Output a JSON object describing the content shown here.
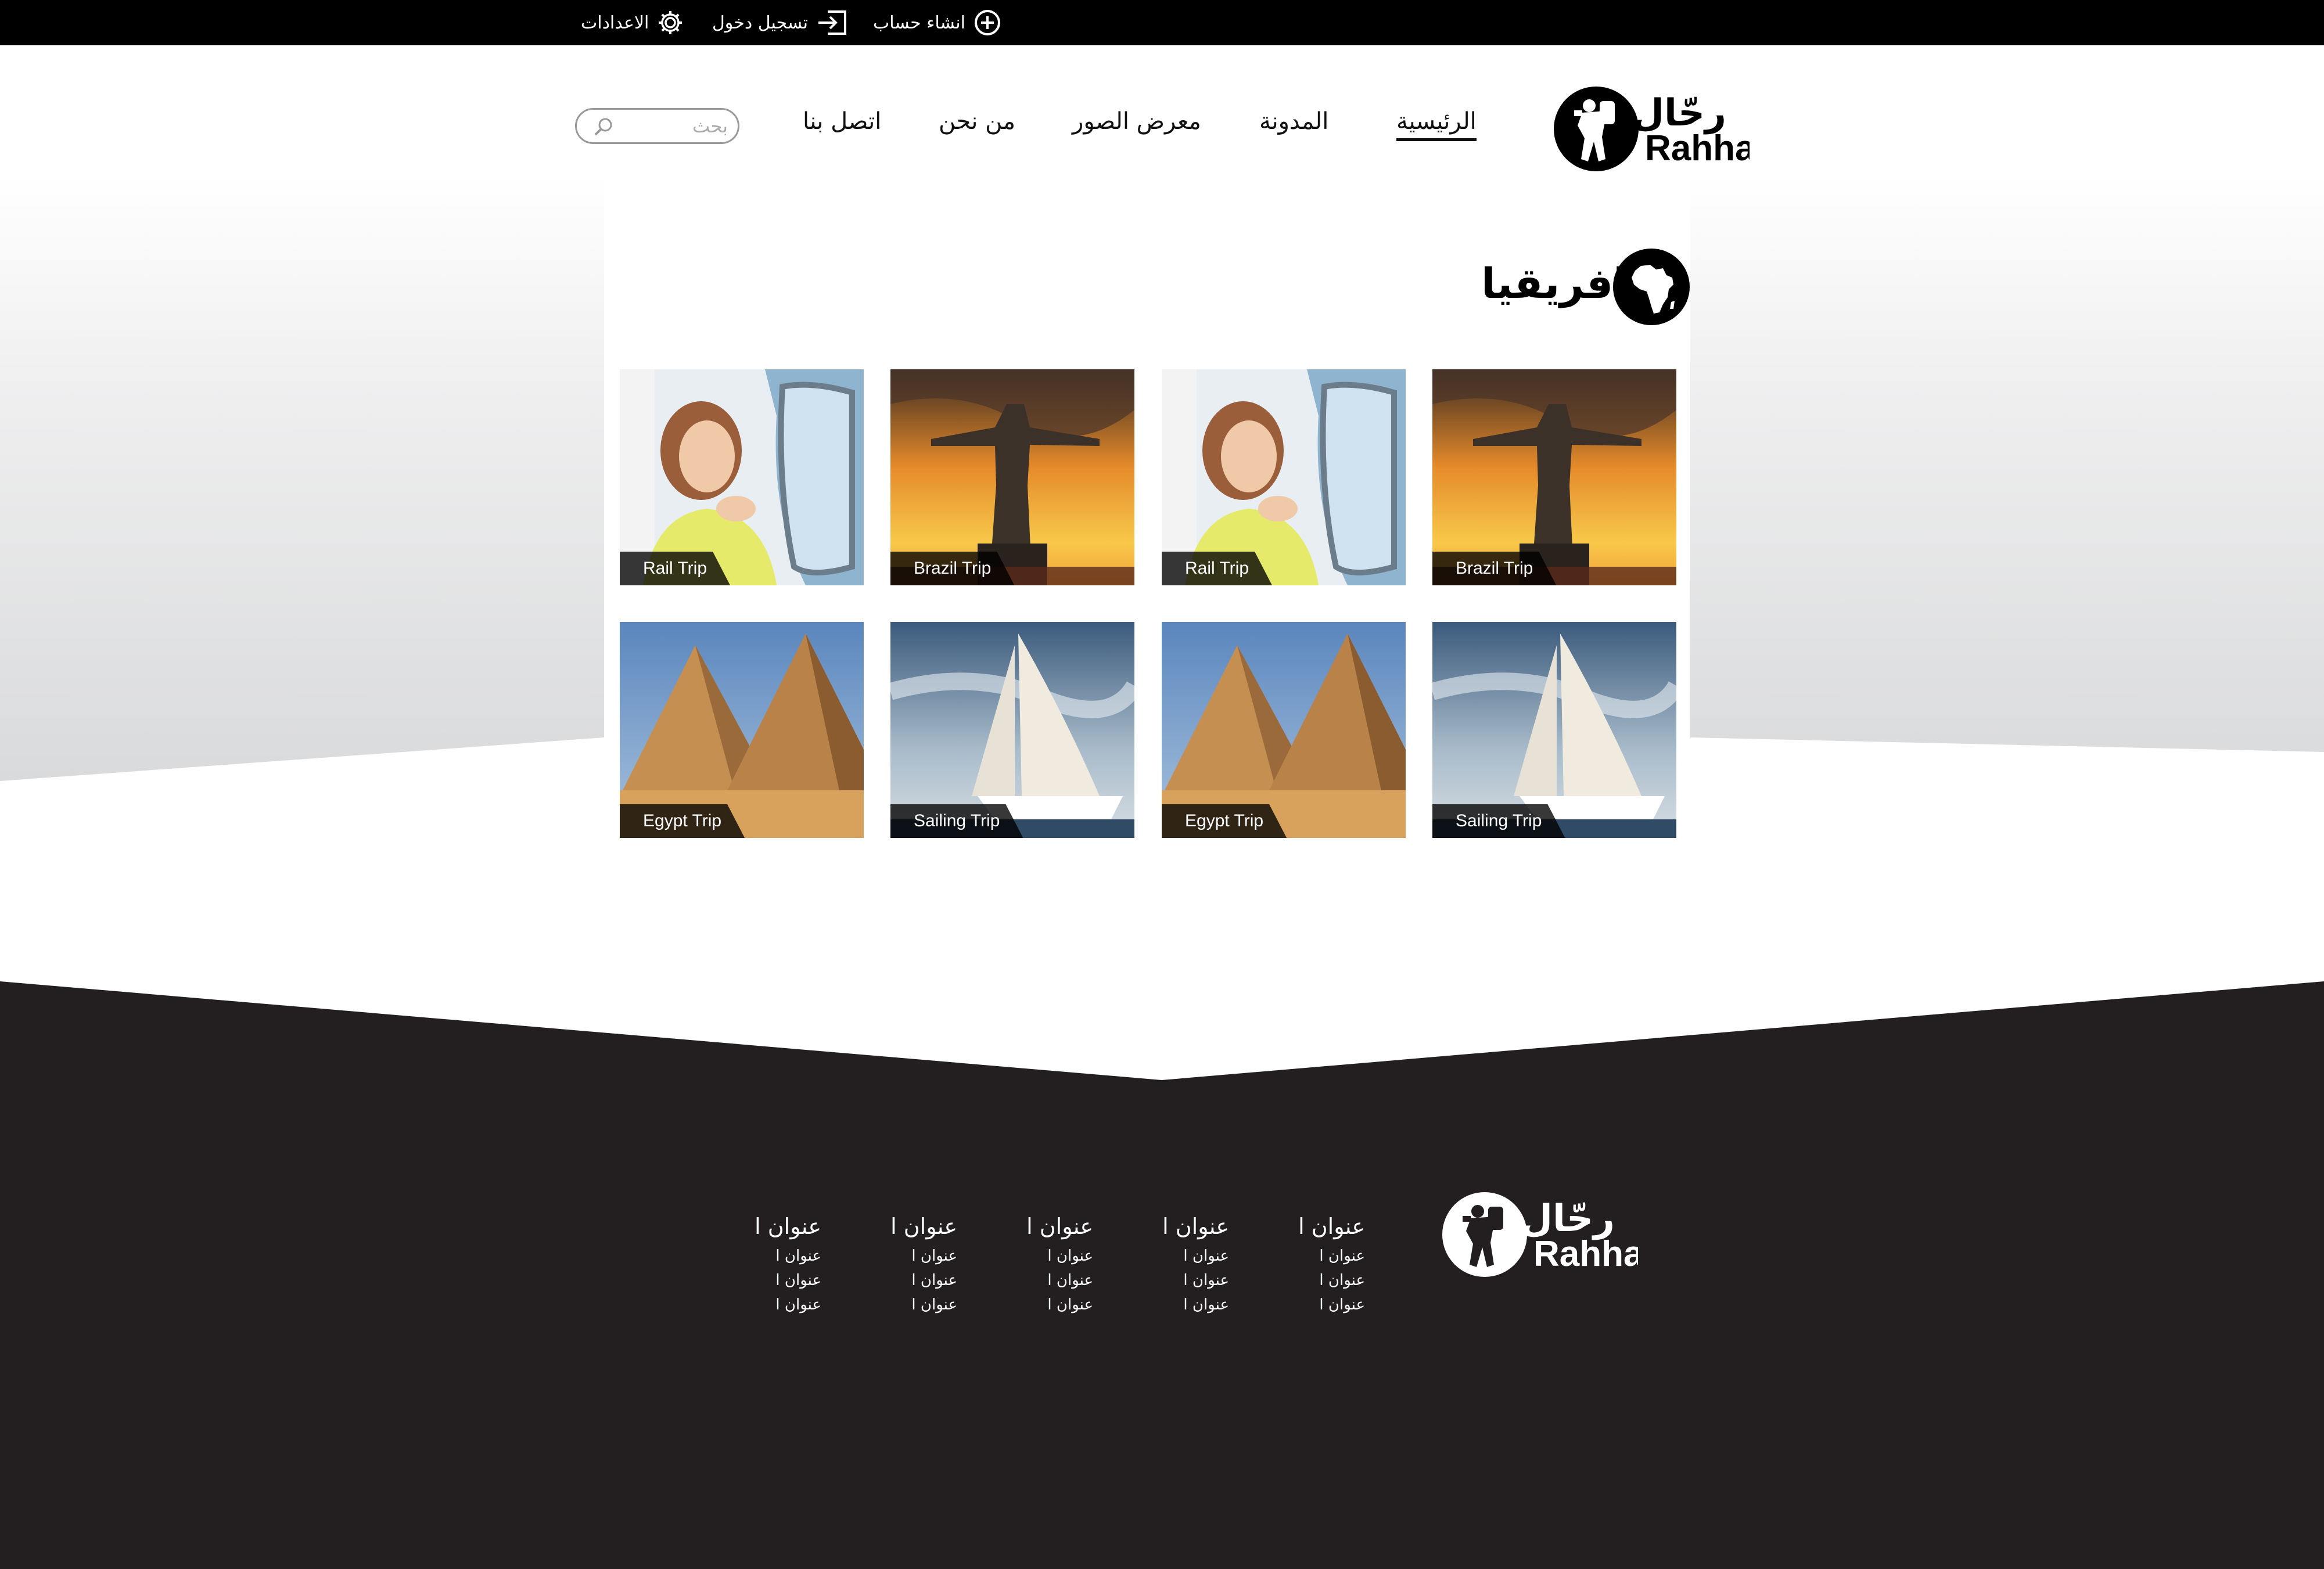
{
  "topbar": {
    "create_account": "انشاء حساب",
    "login": "تسجيل دخول",
    "settings": "الاعدادات"
  },
  "brand": {
    "arabic": "رحّال",
    "latin": "Rahhal"
  },
  "nav": {
    "home": "الرئيسية",
    "blog": "المدونة",
    "gallery": "معرض الصور",
    "about": "من نحن",
    "contact": "اتصل بنا"
  },
  "search": {
    "placeholder": "بحث"
  },
  "section": {
    "title": "افريقيا",
    "icon": "africa-icon"
  },
  "gallery": {
    "items": [
      {
        "caption": "Brazil Trip",
        "image": "christ-redeemer"
      },
      {
        "caption": "Rail Trip",
        "image": "woman-train"
      },
      {
        "caption": "Brazil Trip",
        "image": "christ-redeemer"
      },
      {
        "caption": "Rail Trip",
        "image": "woman-train"
      },
      {
        "caption": "Sailing Trip",
        "image": "sailboat"
      },
      {
        "caption": "Egypt Trip",
        "image": "pyramids"
      },
      {
        "caption": "Sailing Trip",
        "image": "sailboat"
      },
      {
        "caption": "Egypt Trip",
        "image": "pyramids"
      }
    ]
  },
  "footer": {
    "columns": [
      {
        "heading": "عنوان ا",
        "links": [
          "عنوان ا",
          "عنوان ا",
          "عنوان ا"
        ]
      },
      {
        "heading": "عنوان ا",
        "links": [
          "عنوان ا",
          "عنوان ا",
          "عنوان ا"
        ]
      },
      {
        "heading": "عنوان ا",
        "links": [
          "عنوان ا",
          "عنوان ا",
          "عنوان ا"
        ]
      },
      {
        "heading": "عنوان ا",
        "links": [
          "عنوان ا",
          "عنوان ا",
          "عنوان ا"
        ]
      },
      {
        "heading": "عنوان ا",
        "links": [
          "عنوان ا",
          "عنوان ا",
          "عنوان ا"
        ]
      }
    ]
  },
  "colors": {
    "topbar": "#000000",
    "footer": "#231f20",
    "text": "#111111"
  }
}
